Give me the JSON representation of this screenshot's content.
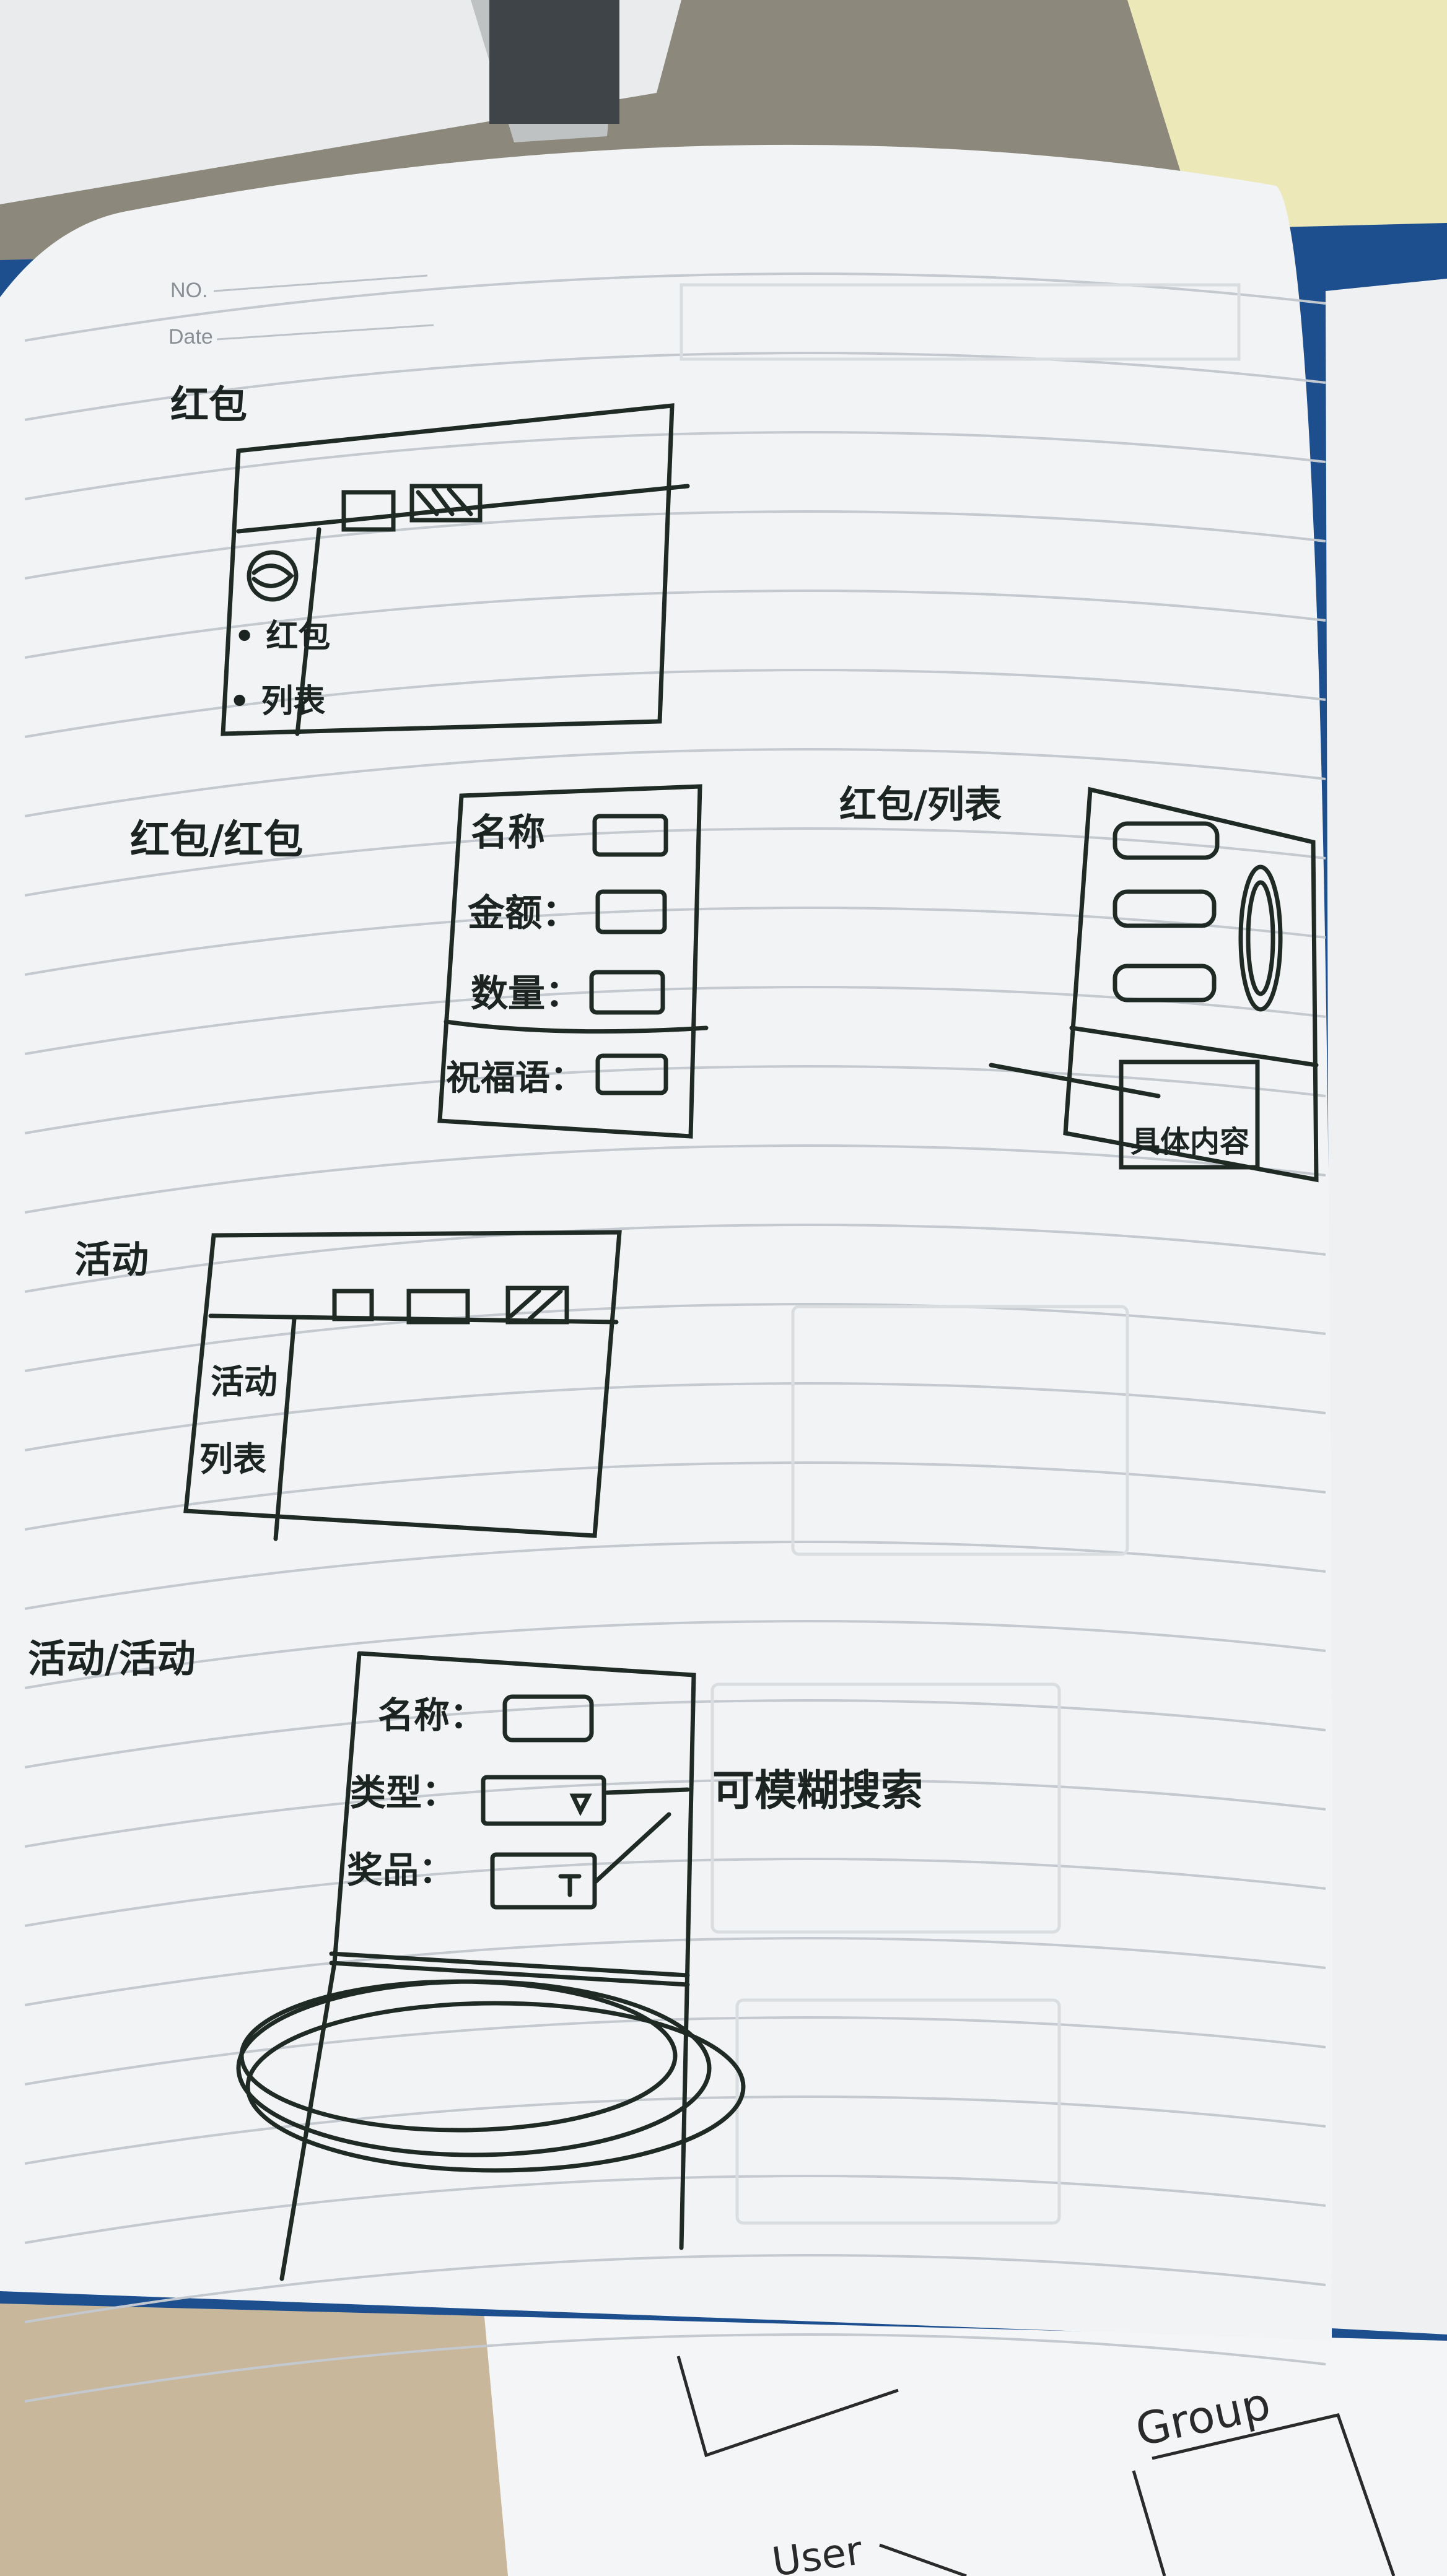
{
  "notebook": {
    "printed_header": {
      "no": "NO.",
      "date": "Date"
    }
  },
  "sketches": {
    "red_packet": {
      "title": "红包",
      "sidebar_items": [
        "• 红包",
        "• 列表"
      ]
    },
    "red_packet_form": {
      "title": "红包/红包",
      "fields": [
        "名称",
        "金额：",
        "数量：",
        "祝福语："
      ]
    },
    "red_packet_list": {
      "title": "红包/列表",
      "detail_label": "具体内容"
    },
    "activity": {
      "title": "活动",
      "sidebar_items": [
        "活动",
        "列表"
      ]
    },
    "activity_form": {
      "title": "活动/活动",
      "fields": [
        "名称：",
        "类型：",
        "奖品："
      ],
      "note": "可模糊搜索"
    }
  },
  "background_sheet": {
    "labels": [
      "Group",
      "User"
    ]
  }
}
